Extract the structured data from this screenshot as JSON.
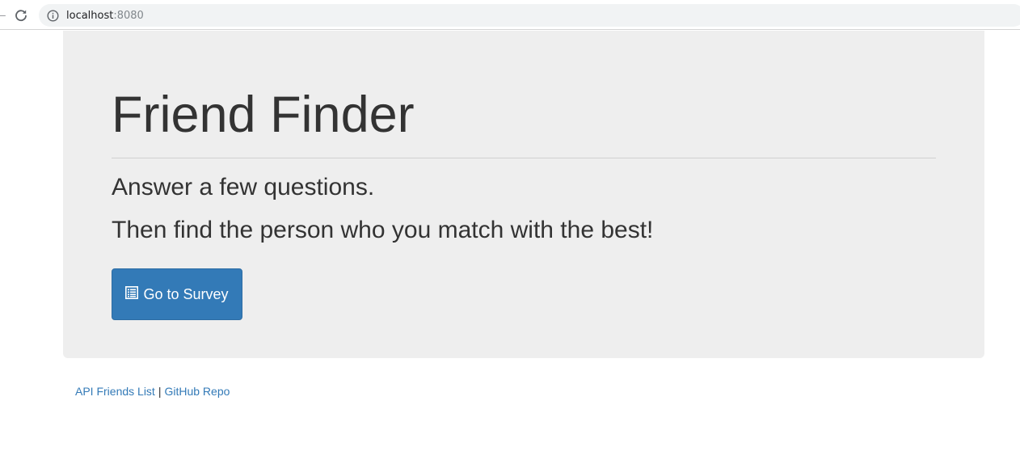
{
  "browser": {
    "url_host": "localhost",
    "url_port": ":8080",
    "back_icon": "arrow-left-icon",
    "reload_icon": "reload-icon",
    "info_icon": "info-icon"
  },
  "jumbotron": {
    "title": "Friend Finder",
    "lead_1": "Answer a few questions.",
    "lead_2": "Then find the person who you match with the best!",
    "button_label": "Go to Survey",
    "button_icon": "list-alt-icon",
    "background_color": "#eeeeee",
    "button_color": "#337ab7"
  },
  "footer": {
    "link_1": "API Friends List",
    "separator": "|",
    "link_2": "GitHub Repo",
    "link_color": "#337ab7"
  }
}
